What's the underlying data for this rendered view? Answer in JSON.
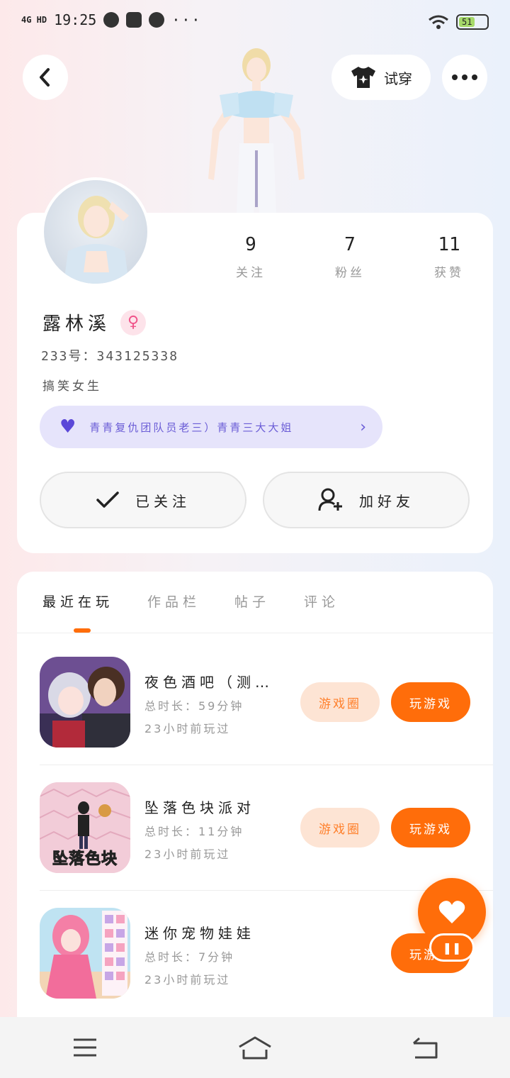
{
  "status_bar": {
    "network": "4G HD",
    "time": "19:25",
    "more": "···",
    "battery": "51"
  },
  "header": {
    "tryon_label": "试穿"
  },
  "profile": {
    "stats": [
      {
        "value": "9",
        "label": "关注"
      },
      {
        "value": "7",
        "label": "粉丝"
      },
      {
        "value": "11",
        "label": "获赞"
      }
    ],
    "username": "露林溪",
    "gender_symbol": "♀",
    "user_id": "233号：343125338",
    "bio": "搞笑女生",
    "group_banner": "青青复仇团队员老三）青青三大大姐",
    "follow_label": "已关注",
    "add_friend_label": "加好友"
  },
  "tabs": [
    {
      "label": "最近在玩",
      "active": true
    },
    {
      "label": "作品栏",
      "active": false
    },
    {
      "label": "帖子",
      "active": false
    },
    {
      "label": "评论",
      "active": false
    }
  ],
  "games": [
    {
      "title": "夜色酒吧（测…",
      "duration": "总时长：59分钟",
      "last_played": "23小时前玩过",
      "circle_label": "游戏圈",
      "play_label": "玩游戏"
    },
    {
      "title": "坠落色块派对",
      "duration": "总时长：11分钟",
      "last_played": "23小时前玩过",
      "circle_label": "游戏圈",
      "play_label": "玩游戏",
      "thumb_text": "坠落色块"
    },
    {
      "title": "迷你宠物娃娃",
      "duration": "总时长：7分钟",
      "last_played": "23小时前玩过",
      "play_label": "玩游戏"
    }
  ],
  "colors": {
    "accent": "#ff6d0a",
    "accent_light": "#fde4d4",
    "banner_bg": "#e6e4fb",
    "banner_text": "#6a5cd6"
  }
}
